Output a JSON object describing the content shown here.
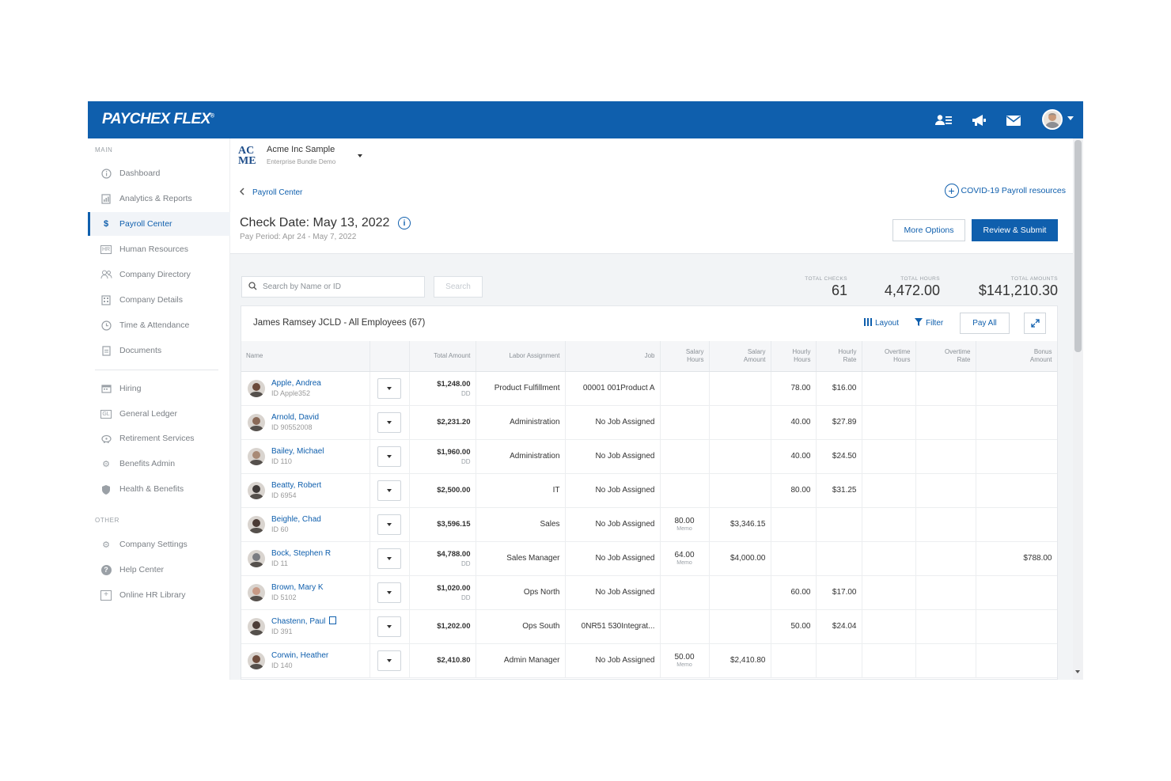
{
  "app": {
    "logo": "PAYCHEX FLEX",
    "logo_mark": "®",
    "header_icons": [
      "people-icon",
      "megaphone-icon",
      "mail-icon",
      "avatar"
    ]
  },
  "sidebar": {
    "main_label": "MAIN",
    "other_label": "OTHER",
    "main_items": [
      {
        "label": "Dashboard",
        "icon": "info-circle-icon"
      },
      {
        "label": "Analytics & Reports",
        "icon": "report-icon"
      },
      {
        "label": "Payroll Center",
        "icon": "dollar-icon",
        "active": true
      },
      {
        "label": "Human Resources",
        "icon": "hr-icon"
      },
      {
        "label": "Company Directory",
        "icon": "people-icon"
      },
      {
        "label": "Company Details",
        "icon": "building-icon"
      },
      {
        "label": "Time & Attendance",
        "icon": "clock-icon"
      },
      {
        "label": "Documents",
        "icon": "document-icon"
      }
    ],
    "secondary_items": [
      {
        "label": "Hiring",
        "icon": "calendar-icon"
      },
      {
        "label": "General Ledger",
        "icon": "gl-icon"
      },
      {
        "label": "Retirement Services",
        "icon": "piggy-bank-icon"
      },
      {
        "label": "Benefits Admin",
        "icon": "gear-icon"
      },
      {
        "label": "Health & Benefits",
        "icon": "shield-icon"
      }
    ],
    "other_items": [
      {
        "label": "Company Settings",
        "icon": "gear-icon"
      },
      {
        "label": "Help Center",
        "icon": "help-icon"
      },
      {
        "label": "Online HR Library",
        "icon": "plus-box-icon"
      }
    ]
  },
  "company": {
    "logo_top": "AC",
    "logo_bottom": "ME",
    "name": "Acme Inc Sample",
    "subtitle": "Enterprise Bundle Demo"
  },
  "page": {
    "back_label": "Payroll Center",
    "covid_link": "COVID-19 Payroll resources",
    "check_date": "Check Date: May 13, 2022",
    "pay_period": "Pay Period: Apr 24 - May 7, 2022",
    "more_options": "More Options",
    "review_submit": "Review & Submit"
  },
  "search": {
    "placeholder": "Search by Name or ID",
    "button": "Search"
  },
  "stats": {
    "total_checks_label": "TOTAL CHECKS",
    "total_checks": "61",
    "total_hours_label": "TOTAL HOURS",
    "total_hours": "4,472.00",
    "total_amounts_label": "TOTAL AMOUNTS",
    "total_amounts": "$141,210.30"
  },
  "card": {
    "title": "James Ramsey JCLD - All Employees (67)",
    "layout_label": "Layout",
    "filter_label": "Filter",
    "pay_all_label": "Pay All"
  },
  "table": {
    "headers": {
      "name": "Name",
      "total_amount": "Total Amount",
      "labor_assignment": "Labor Assignment",
      "job": "Job",
      "salary_hours": [
        "Salary",
        "Hours"
      ],
      "salary_amount": [
        "Salary",
        "Amount"
      ],
      "hourly_hours": [
        "Hourly",
        "Hours"
      ],
      "hourly_rate": [
        "Hourly",
        "Rate"
      ],
      "overtime_hours": [
        "Overtime",
        "Hours"
      ],
      "overtime_rate": [
        "Overtime",
        "Rate"
      ],
      "bonus_amount": [
        "Bonus",
        "Amount"
      ]
    },
    "rows": [
      {
        "name": "Apple, Andrea",
        "id": "ID Apple352",
        "total": "$1,248.00",
        "dd": "DD",
        "labor": "Product Fulfillment",
        "job": "00001 001Product A",
        "sal_hours": "",
        "sal_memo": "",
        "sal_amount": "",
        "hr_hours": "78.00",
        "hr_rate": "$16.00",
        "ot_hours": "",
        "ot_rate": "",
        "bonus": ""
      },
      {
        "name": "Arnold, David",
        "id": "ID 90552008",
        "total": "$2,231.20",
        "dd": "",
        "labor": "Administration",
        "job": "No Job Assigned",
        "sal_hours": "",
        "sal_memo": "",
        "sal_amount": "",
        "hr_hours": "40.00",
        "hr_rate": "$27.89",
        "ot_hours": "",
        "ot_rate": "",
        "bonus": ""
      },
      {
        "name": "Bailey, Michael",
        "id": "ID 110",
        "total": "$1,960.00",
        "dd": "DD",
        "labor": "Administration",
        "job": "No Job Assigned",
        "sal_hours": "",
        "sal_memo": "",
        "sal_amount": "",
        "hr_hours": "40.00",
        "hr_rate": "$24.50",
        "ot_hours": "",
        "ot_rate": "",
        "bonus": ""
      },
      {
        "name": "Beatty, Robert",
        "id": "ID 6954",
        "total": "$2,500.00",
        "dd": "",
        "labor": "IT",
        "job": "No Job Assigned",
        "sal_hours": "",
        "sal_memo": "",
        "sal_amount": "",
        "hr_hours": "80.00",
        "hr_rate": "$31.25",
        "ot_hours": "",
        "ot_rate": "",
        "bonus": ""
      },
      {
        "name": "Beighle, Chad",
        "id": "ID 60",
        "total": "$3,596.15",
        "dd": "",
        "labor": "Sales",
        "job": "No Job Assigned",
        "sal_hours": "80.00",
        "sal_memo": "Memo",
        "sal_amount": "$3,346.15",
        "hr_hours": "",
        "hr_rate": "",
        "ot_hours": "",
        "ot_rate": "",
        "bonus": ""
      },
      {
        "name": "Bock, Stephen R",
        "id": "ID 11",
        "total": "$4,788.00",
        "dd": "DD",
        "labor": "Sales Manager",
        "job": "No Job Assigned",
        "sal_hours": "64.00",
        "sal_memo": "Memo",
        "sal_amount": "$4,000.00",
        "hr_hours": "",
        "hr_rate": "",
        "ot_hours": "",
        "ot_rate": "",
        "bonus": "$788.00"
      },
      {
        "name": "Brown, Mary K",
        "id": "ID 5102",
        "total": "$1,020.00",
        "dd": "DD",
        "labor": "Ops North",
        "job": "No Job Assigned",
        "sal_hours": "",
        "sal_memo": "",
        "sal_amount": "",
        "hr_hours": "60.00",
        "hr_rate": "$17.00",
        "ot_hours": "",
        "ot_rate": "",
        "bonus": ""
      },
      {
        "name": "Chastenn, Paul",
        "id": "ID 391",
        "total": "$1,202.00",
        "dd": "",
        "labor": "Ops South",
        "job": "0NR51 530Integrat...",
        "sal_hours": "",
        "sal_memo": "",
        "sal_amount": "",
        "hr_hours": "50.00",
        "hr_rate": "$24.04",
        "ot_hours": "",
        "ot_rate": "",
        "bonus": ""
      },
      {
        "name": "Corwin, Heather",
        "id": "ID 140",
        "total": "$2,410.80",
        "dd": "",
        "labor": "Admin Manager",
        "job": "No Job Assigned",
        "sal_hours": "50.00",
        "sal_memo": "Memo",
        "sal_amount": "$2,410.80",
        "hr_hours": "",
        "hr_rate": "",
        "ot_hours": "",
        "ot_rate": "",
        "bonus": ""
      }
    ]
  },
  "colors": {
    "brand": "#0f5fad",
    "link": "#0f5fad",
    "gray_bg": "#f2f4f6"
  }
}
